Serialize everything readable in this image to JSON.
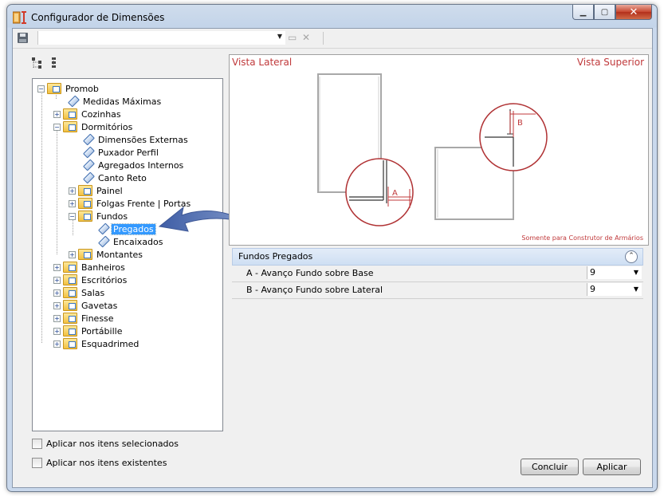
{
  "window": {
    "title": "Configurador de Dimensões"
  },
  "tree": {
    "root": "Promob",
    "items": {
      "medidas": "Medidas Máximas",
      "cozinhas": "Cozinhas",
      "dormitorios": "Dormitórios",
      "dim_externas": "Dimensões Externas",
      "puxador": "Puxador Perfil",
      "agregados": "Agregados Internos",
      "canto": "Canto Reto",
      "painel": "Painel",
      "folgas": "Folgas Frente | Portas",
      "fundos": "Fundos",
      "pregados": "Pregados",
      "encaixados": "Encaixados",
      "montantes": "Montantes",
      "banheiros": "Banheiros",
      "escritorios": "Escritórios",
      "salas": "Salas",
      "gavetas": "Gavetas",
      "finesse": "Finesse",
      "portabille": "Portábille",
      "esquadrimed": "Esquadrimed"
    },
    "selected": "Pregados"
  },
  "options": {
    "apply_selected": "Aplicar nos itens selecionados",
    "apply_existing": "Aplicar nos itens existentes"
  },
  "preview": {
    "left_title": "Vista Lateral",
    "right_title": "Vista Superior",
    "label_a": "A",
    "label_b": "B",
    "note": "Somente para Construtor de Armários",
    "accent": "#c0393b"
  },
  "properties": {
    "section": "Fundos Pregados",
    "rows": [
      {
        "name": "A - Avanço Fundo sobre Base",
        "value": "9"
      },
      {
        "name": "B - Avanço Fundo sobre Lateral",
        "value": "9"
      }
    ]
  },
  "buttons": {
    "concluir": "Concluir",
    "aplicar": "Aplicar"
  }
}
